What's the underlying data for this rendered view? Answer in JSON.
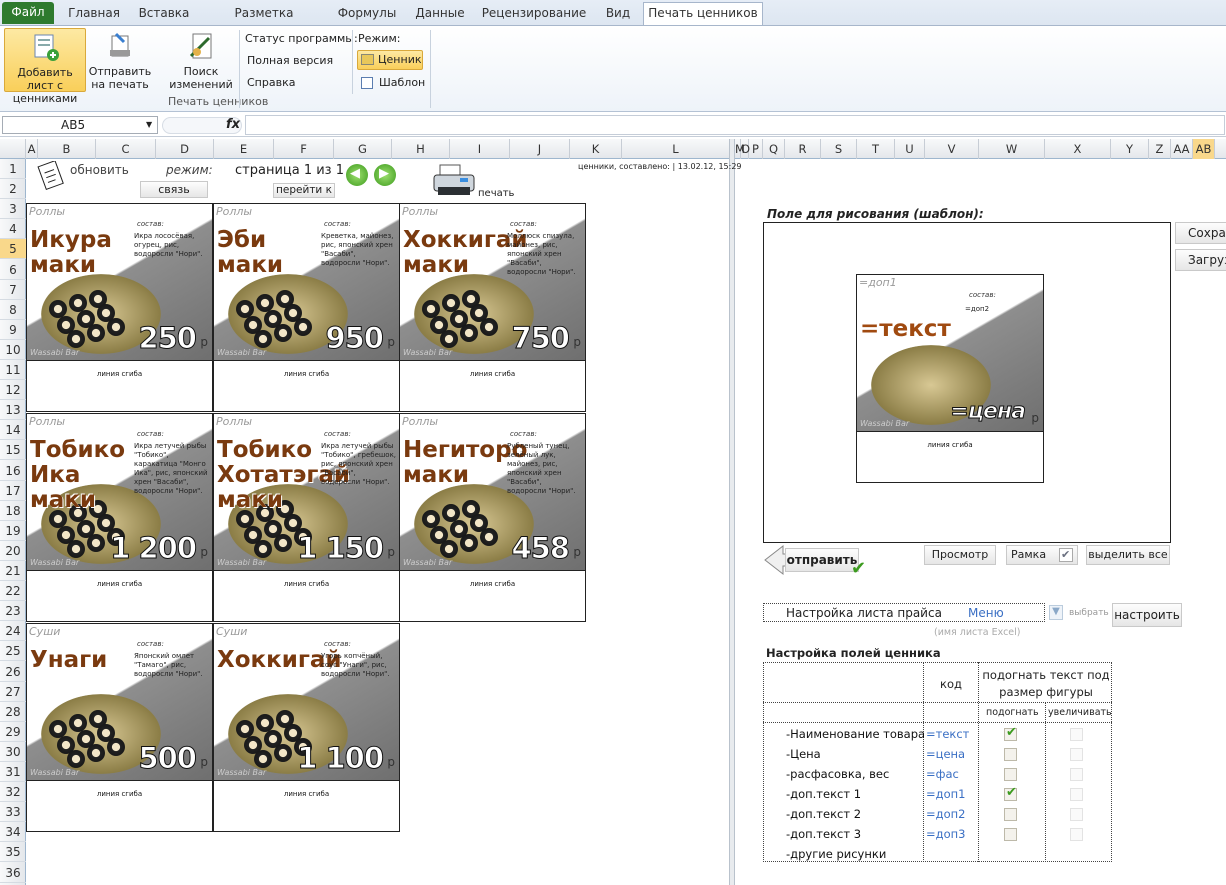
{
  "tabs": [
    "Файл",
    "Главная",
    "Вставка",
    "Разметка страницы",
    "Формулы",
    "Данные",
    "Рецензирование",
    "Вид",
    "Печать ценников"
  ],
  "ribbon": {
    "add_sheet": "Добавить лист с ценниками",
    "send_print": "Отправить на печать",
    "search": "Поиск изменений",
    "status": "Статус программы:",
    "full": "Полная версия",
    "help": "Справка",
    "mode": "Режим:",
    "price_tag": "Ценник",
    "template": "Шаблон",
    "group": "Печать ценников"
  },
  "formula": {
    "cell": "AB5",
    "fx": "fx"
  },
  "columns": [
    "A",
    "B",
    "C",
    "D",
    "E",
    "F",
    "G",
    "H",
    "I",
    "J",
    "K",
    "L",
    "M",
    "O",
    "P",
    "Q",
    "R",
    "S",
    "T",
    "U",
    "V",
    "W",
    "X",
    "Y",
    "Z",
    "AA",
    "AB"
  ],
  "rows": [
    "1",
    "2",
    "3",
    "4",
    "5",
    "6",
    "7",
    "8",
    "9",
    "10",
    "11",
    "12",
    "13",
    "14",
    "15",
    "16",
    "17",
    "18",
    "19",
    "20",
    "21",
    "22",
    "23",
    "24",
    "25",
    "26",
    "27",
    "28",
    "29",
    "30",
    "31",
    "32",
    "33",
    "34",
    "35",
    "36"
  ],
  "sheet_top": {
    "refresh": "обновить",
    "mode_label": "режим:",
    "mode_value": "связь",
    "page": "страница 1 из 1",
    "goto": "перейти к",
    "print": "печать",
    "stamp": "ценники, составлено: | 13.02.12, 15:29"
  },
  "cards": [
    {
      "cat": "Роллы",
      "name": "Икура маки",
      "sost": "состав:",
      "desc": "Икра лососёвая, огурец, рис, водоросли \"Нори\".",
      "price": "250",
      "rub": "р",
      "brand": "Wassabi Bar",
      "fold": "линия сгиба"
    },
    {
      "cat": "Роллы",
      "name": "Эби маки",
      "sost": "состав:",
      "desc": "Креветка, майонез, рис, японский хрен \"Васаби\", водоросли \"Нори\".",
      "price": "950",
      "rub": "р",
      "brand": "Wassabi Bar",
      "fold": "линия сгиба"
    },
    {
      "cat": "Роллы",
      "name": "Хоккигай маки",
      "sost": "состав:",
      "desc": "Моллюск спизула, майонез, рис, японский хрен \"Васаби\", водоросли \"Нори\".",
      "price": "750",
      "rub": "р",
      "brand": "Wassabi Bar",
      "fold": "линия сгиба"
    },
    {
      "cat": "Роллы",
      "name": "Тобико Ика маки",
      "sost": "состав:",
      "desc": "Икра летучей рыбы \"Тобико\", каракатица \"Монго Ика\", рис, японский хрен \"Васаби\", водоросли \"Нори\".",
      "price": "1 200",
      "rub": "р",
      "brand": "Wassabi Bar",
      "fold": "линия сгиба"
    },
    {
      "cat": "Роллы",
      "name": "Тобико Хотатэгай маки",
      "sost": "состав:",
      "desc": "Икра летучей рыбы \"Тобико\", гребешок, рис, японский хрен \"Васаби\", водоросли \"Нори\".",
      "price": "1 150",
      "rub": "р",
      "brand": "Wassabi Bar",
      "fold": "линия сгиба"
    },
    {
      "cat": "Роллы",
      "name": "Негиторо маки",
      "sost": "состав:",
      "desc": "Рубленый тунец, зелёный лук, майонез, рис, японский хрен \"Васаби\", водоросли \"Нори\".",
      "price": "458",
      "rub": "р",
      "brand": "Wassabi Bar",
      "fold": "линия сгиба"
    },
    {
      "cat": "Суши",
      "name": "Унаги",
      "sost": "состав:",
      "desc": "Японский омлет \"Тамаго\", рис, водоросли \"Нори\".",
      "price": "500",
      "rub": "р",
      "brand": "Wassabi Bar",
      "fold": "линия сгиба"
    },
    {
      "cat": "Суши",
      "name": "Хоккигай",
      "sost": "состав:",
      "desc": "Угорь копчёный, соус \"Унаги\", рис, водоросли \"Нори\".",
      "price": "1 100",
      "rub": "р",
      "brand": "Wassabi Bar",
      "fold": "линия сгиба"
    }
  ],
  "right": {
    "canvas_title": "Поле для рисования (шаблон):",
    "save": "Сохран",
    "load": "Загруз",
    "tpl": {
      "cat": "=доп1",
      "sost": "состав:",
      "dop2": "=доп2",
      "text": "=текст",
      "price": "=цена",
      "rub": "р",
      "brand": "Wassabi Bar",
      "fold": "линия сгиба"
    },
    "send": "отправить",
    "preview": "Просмотр",
    "frame": "Рамка",
    "select_all": "выделить все",
    "settings_label": "Настройка листа прайса",
    "menu": "Меню",
    "choose": "выбрать",
    "configure": "настроить",
    "sheet_hint": "(имя листа Excel)",
    "fields_title": "Настройка полей ценника",
    "col_code": "код",
    "col_fit": "подогнать текст под размер фигуры",
    "col_fit_a": "подогнать",
    "col_fit_b": "увеличивать",
    "fields": [
      {
        "label": "-Наименование товара",
        "code": "=текст",
        "fit": true
      },
      {
        "label": "-Цена",
        "code": "=цена",
        "fit": false
      },
      {
        "label": "-расфасовка, вес",
        "code": "=фас",
        "fit": false
      },
      {
        "label": "-доп.текст 1",
        "code": "=доп1",
        "fit": true
      },
      {
        "label": "-доп.текст 2",
        "code": "=доп2",
        "fit": false
      },
      {
        "label": "-доп.текст 3",
        "code": "=доп3",
        "fit": false
      },
      {
        "label": "-другие рисунки",
        "code": "",
        "fit": null
      }
    ]
  }
}
